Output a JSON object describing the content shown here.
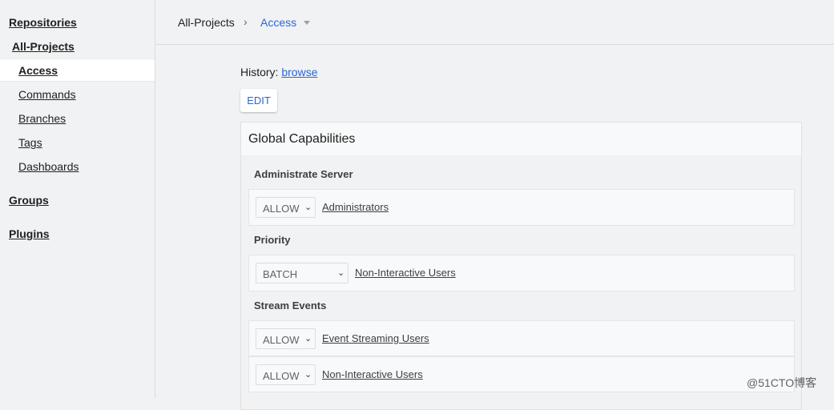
{
  "sidebar": {
    "repositories": "Repositories",
    "project": "All-Projects",
    "items": [
      {
        "label": "Access"
      },
      {
        "label": "Commands"
      },
      {
        "label": "Branches"
      },
      {
        "label": "Tags"
      },
      {
        "label": "Dashboards"
      }
    ],
    "groups": "Groups",
    "plugins": "Plugins"
  },
  "breadcrumb": {
    "project": "All-Projects",
    "separator": "›",
    "current": "Access"
  },
  "history": {
    "label": "History:",
    "link": "browse"
  },
  "edit_label": "EDIT",
  "panel": {
    "title": "Global Capabilities",
    "sections": [
      {
        "name": "Administrate Server",
        "rules": [
          {
            "action": "ALLOW",
            "group": "Administrators"
          }
        ]
      },
      {
        "name": "Priority",
        "rules": [
          {
            "action": "BATCH",
            "group": "Non-Interactive Users"
          }
        ]
      },
      {
        "name": "Stream Events",
        "rules": [
          {
            "action": "ALLOW",
            "group": "Event Streaming Users"
          },
          {
            "action": "ALLOW",
            "group": "Non-Interactive Users"
          }
        ]
      }
    ]
  },
  "watermark": "@51CTO博客",
  "colors": {
    "link_blue": "#2a66d9",
    "background": "#f1f2f3",
    "card": "#f8f9fa"
  }
}
